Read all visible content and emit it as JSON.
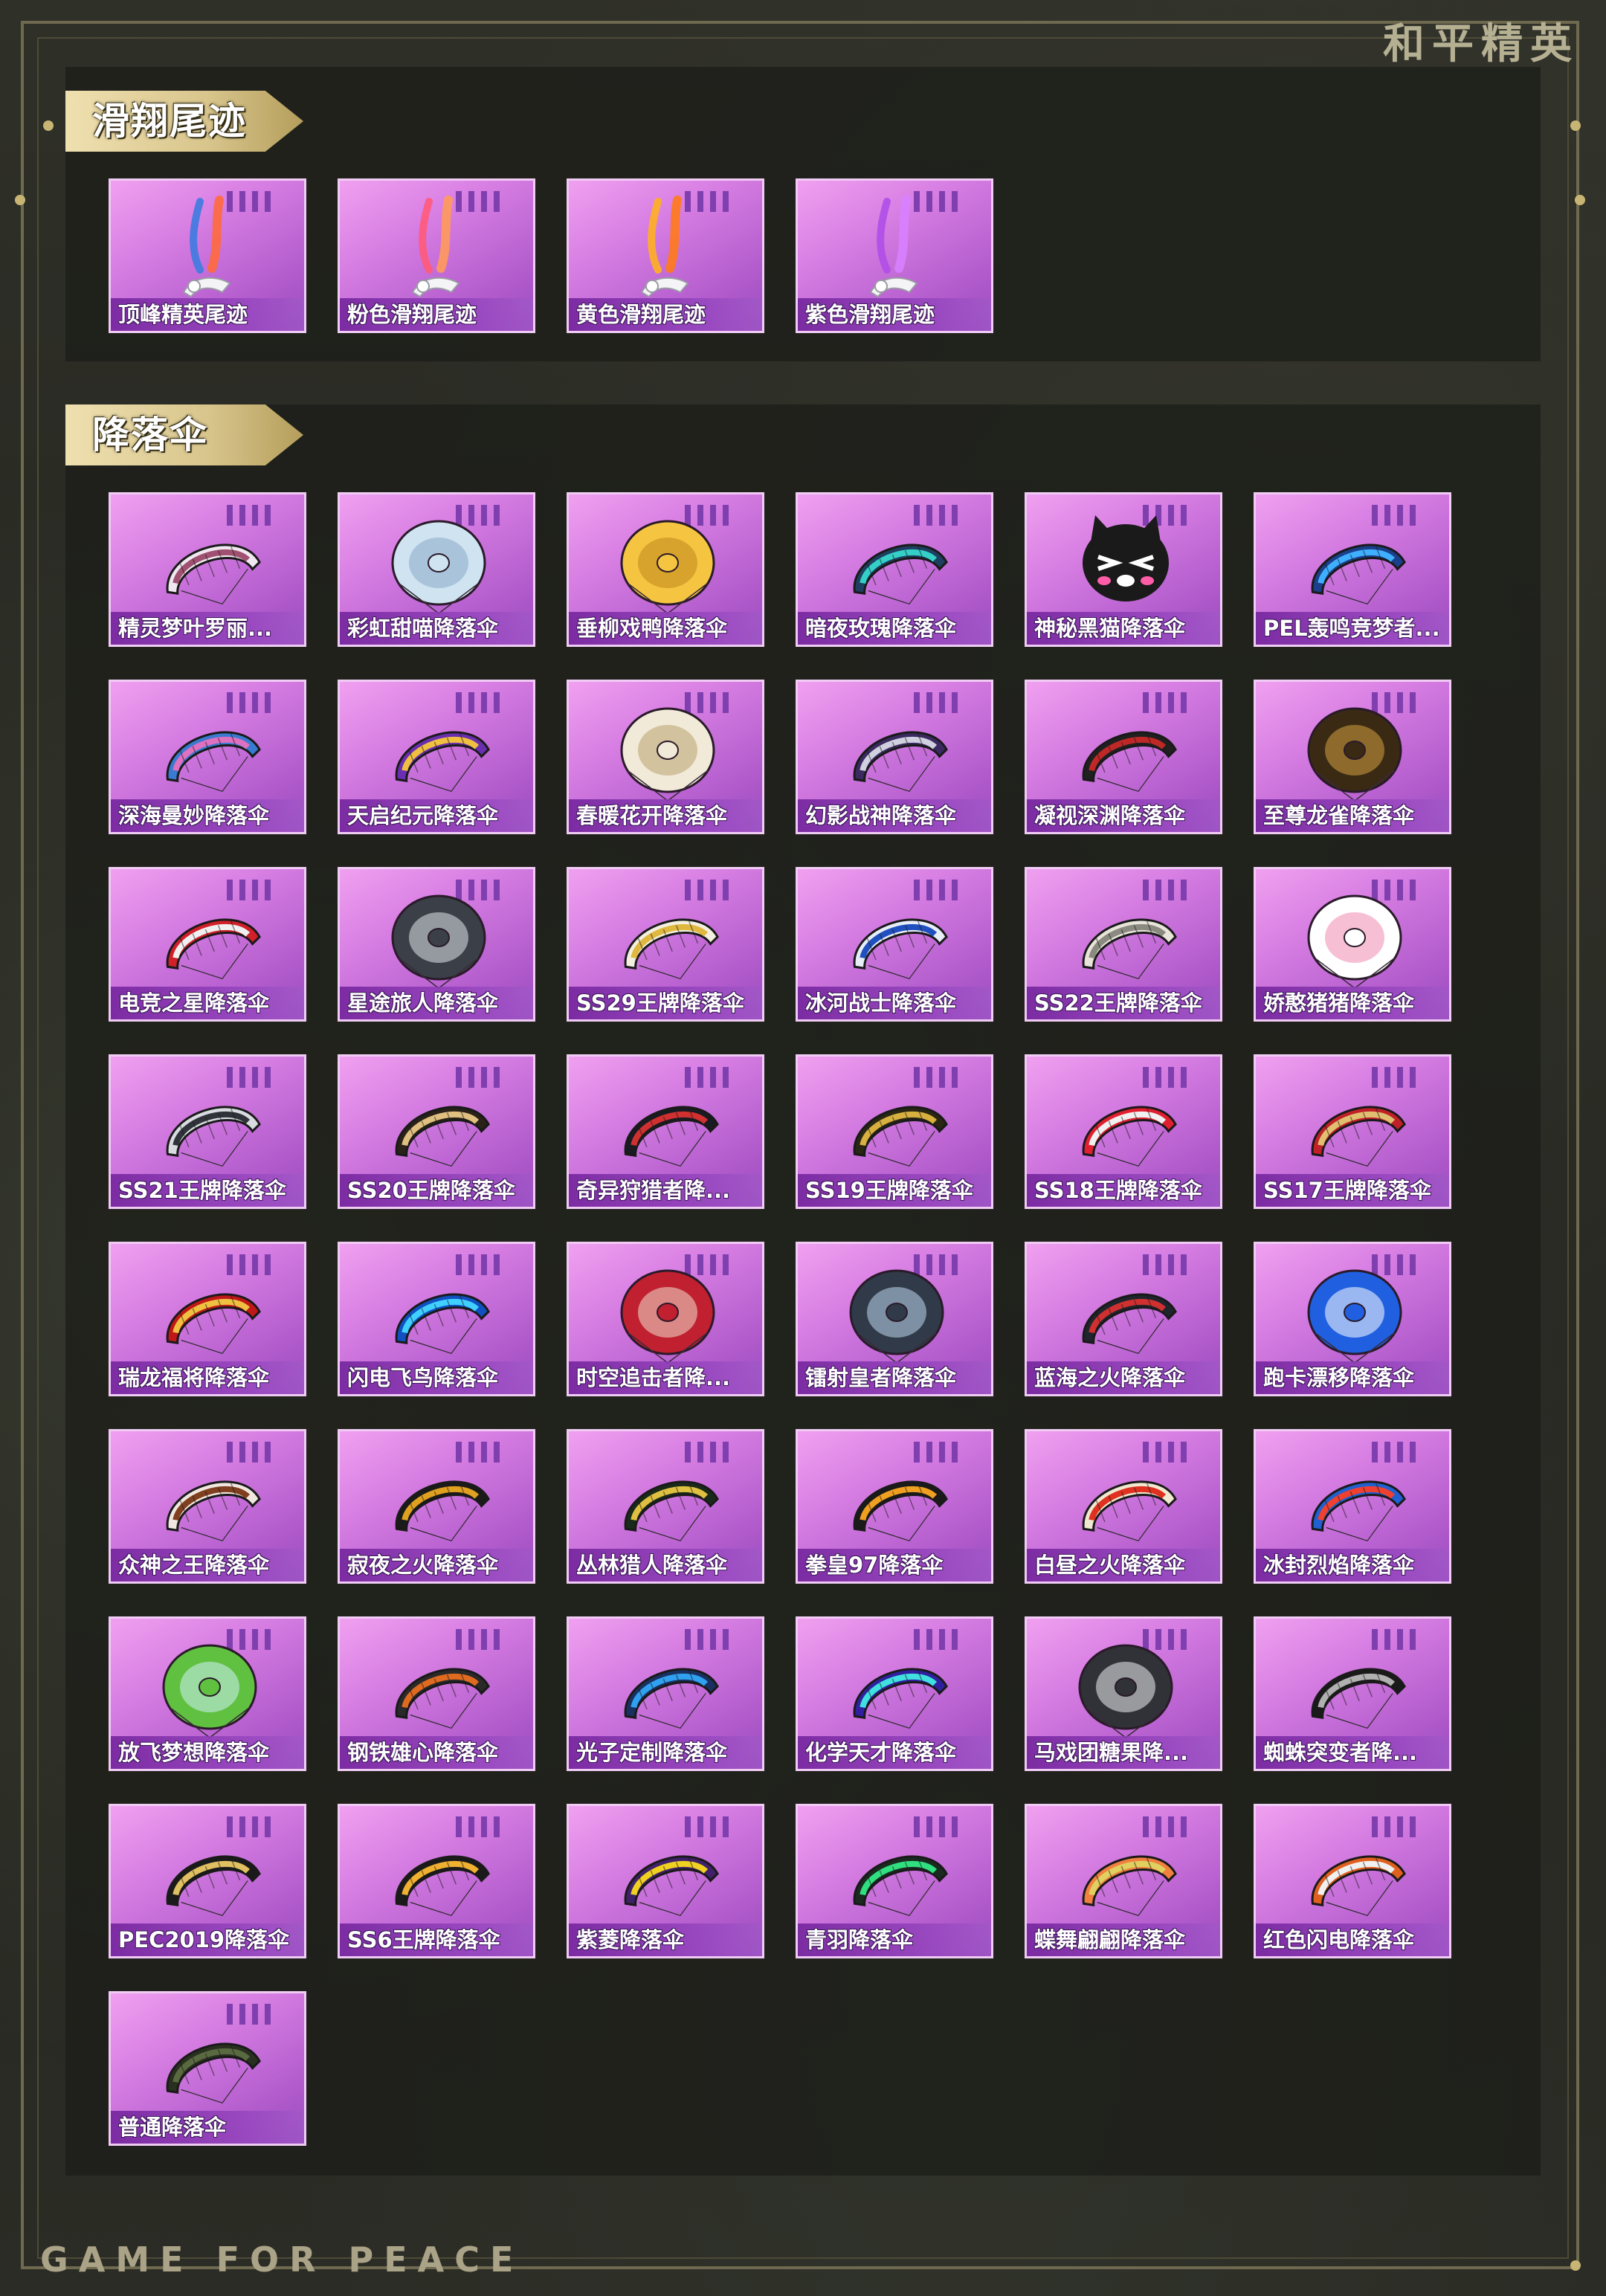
{
  "brand": {
    "top": "和平精英",
    "bottom": "GAME FOR PEACE"
  },
  "colors": {
    "card": "#d77ee3",
    "accent_gold": "#d8c58c",
    "frame": "#6f6a4f"
  },
  "sections": [
    {
      "title": "滑翔尾迹",
      "items": [
        {
          "label": "顶峰精英尾迹",
          "icon": "trail-icon",
          "colors": [
            "#3d7be0",
            "#ff6a3d"
          ]
        },
        {
          "label": "粉色滑翔尾迹",
          "icon": "trail-icon",
          "colors": [
            "#ff5a7a",
            "#ff9a5a"
          ]
        },
        {
          "label": "黄色滑翔尾迹",
          "icon": "trail-icon",
          "colors": [
            "#ffb020",
            "#ff7a1a"
          ]
        },
        {
          "label": "紫色滑翔尾迹",
          "icon": "trail-icon",
          "colors": [
            "#b04ee8",
            "#d880ff"
          ]
        }
      ]
    },
    {
      "title": "降落伞",
      "items": [
        {
          "label": "精灵梦叶罗丽...",
          "icon": "parachute-icon",
          "style": "wing",
          "colors": [
            "#f0e8f0",
            "#a05070"
          ]
        },
        {
          "label": "彩虹甜喵降落伞",
          "icon": "parachute-icon",
          "style": "dome",
          "colors": [
            "#cfe4f0",
            "#8aa8c8"
          ]
        },
        {
          "label": "垂柳戏鸭降落伞",
          "icon": "parachute-icon",
          "style": "dome",
          "colors": [
            "#f5c542",
            "#c0861c"
          ]
        },
        {
          "label": "暗夜玫瑰降落伞",
          "icon": "parachute-icon",
          "style": "wing",
          "colors": [
            "#1f3f60",
            "#34d0c8"
          ]
        },
        {
          "label": "神秘黑猫降落伞",
          "icon": "parachute-icon",
          "style": "cat",
          "colors": [
            "#1a1a1a",
            "#ff5da8"
          ]
        },
        {
          "label": "PEL轰鸣竞梦者...",
          "icon": "parachute-icon",
          "style": "wing",
          "colors": [
            "#1b3f8a",
            "#3fb0ff"
          ]
        },
        {
          "label": "深海曼妙降落伞",
          "icon": "parachute-icon",
          "style": "wing",
          "colors": [
            "#3a7ad0",
            "#e070c0"
          ]
        },
        {
          "label": "天启纪元降落伞",
          "icon": "parachute-icon",
          "style": "wing",
          "colors": [
            "#6a2fb0",
            "#f0c040"
          ]
        },
        {
          "label": "春暖花开降落伞",
          "icon": "parachute-icon",
          "style": "dome",
          "colors": [
            "#f2ead8",
            "#b8a070"
          ]
        },
        {
          "label": "幻影战神降落伞",
          "icon": "parachute-icon",
          "style": "wing",
          "colors": [
            "#3a2a60",
            "#d0d0e0"
          ]
        },
        {
          "label": "凝视深渊降落伞",
          "icon": "parachute-icon",
          "style": "wing",
          "colors": [
            "#202020",
            "#c02828"
          ]
        },
        {
          "label": "至尊龙雀降落伞",
          "icon": "parachute-icon",
          "style": "dome",
          "colors": [
            "#3a2a14",
            "#d4a040"
          ]
        },
        {
          "label": "电竞之星降落伞",
          "icon": "parachute-icon",
          "style": "wing",
          "colors": [
            "#d0202a",
            "#f0f0f0"
          ]
        },
        {
          "label": "星途旅人降落伞",
          "icon": "parachute-icon",
          "style": "dome",
          "colors": [
            "#3a3f48",
            "#e0e4ea"
          ]
        },
        {
          "label": "SS29王牌降落伞",
          "icon": "parachute-icon",
          "style": "wing",
          "colors": [
            "#f4f0e0",
            "#e0b840"
          ]
        },
        {
          "label": "冰河战士降落伞",
          "icon": "parachute-icon",
          "style": "wing",
          "colors": [
            "#e8eef8",
            "#2050c0"
          ]
        },
        {
          "label": "SS22王牌降落伞",
          "icon": "parachute-icon",
          "style": "wing",
          "colors": [
            "#e8e4da",
            "#8a8a80"
          ]
        },
        {
          "label": "娇憨猪猪降落伞",
          "icon": "parachute-icon",
          "style": "dome",
          "colors": [
            "#ffffff",
            "#f08ab0"
          ]
        },
        {
          "label": "SS21王牌降落伞",
          "icon": "parachute-icon",
          "style": "wing",
          "colors": [
            "#d8dce0",
            "#30343a"
          ]
        },
        {
          "label": "SS20王牌降落伞",
          "icon": "parachute-icon",
          "style": "wing",
          "colors": [
            "#2a2218",
            "#e0c080"
          ]
        },
        {
          "label": "奇异狩猎者降...",
          "icon": "parachute-icon",
          "style": "wing",
          "colors": [
            "#1a1a22",
            "#d03030"
          ]
        },
        {
          "label": "SS19王牌降落伞",
          "icon": "parachute-icon",
          "style": "wing",
          "colors": [
            "#2a2614",
            "#d8b040"
          ]
        },
        {
          "label": "SS18王牌降落伞",
          "icon": "parachute-icon",
          "style": "wing",
          "colors": [
            "#e02030",
            "#f0f0f0"
          ]
        },
        {
          "label": "SS17王牌降落伞",
          "icon": "parachute-icon",
          "style": "wing",
          "colors": [
            "#c02028",
            "#e0c070"
          ]
        },
        {
          "label": "瑞龙福将降落伞",
          "icon": "parachute-icon",
          "style": "wing",
          "colors": [
            "#c01818",
            "#f0c040"
          ]
        },
        {
          "label": "闪电飞鸟降落伞",
          "icon": "parachute-icon",
          "style": "wing",
          "colors": [
            "#1050c0",
            "#40d0ff"
          ]
        },
        {
          "label": "时空追击者降...",
          "icon": "parachute-icon",
          "style": "dome",
          "colors": [
            "#c02030",
            "#f0e0d0"
          ]
        },
        {
          "label": "镭射皇者降落伞",
          "icon": "parachute-icon",
          "style": "dome",
          "colors": [
            "#303a48",
            "#c0d8f0"
          ]
        },
        {
          "label": "蓝海之火降落伞",
          "icon": "parachute-icon",
          "style": "wing",
          "colors": [
            "#20242c",
            "#d03030"
          ]
        },
        {
          "label": "跑卡漂移降落伞",
          "icon": "parachute-icon",
          "style": "dome",
          "colors": [
            "#2060e0",
            "#ffffff"
          ]
        },
        {
          "label": "众神之王降落伞",
          "icon": "parachute-icon",
          "style": "wing",
          "colors": [
            "#f0e8e0",
            "#804020"
          ]
        },
        {
          "label": "寂夜之火降落伞",
          "icon": "parachute-icon",
          "style": "wing",
          "colors": [
            "#1a1a1a",
            "#e0a020"
          ]
        },
        {
          "label": "丛林猎人降落伞",
          "icon": "parachute-icon",
          "style": "wing",
          "colors": [
            "#1a2a1a",
            "#e0c040"
          ]
        },
        {
          "label": "拳皇97降落伞",
          "icon": "parachute-icon",
          "style": "wing",
          "colors": [
            "#1a1a1a",
            "#f0a020"
          ]
        },
        {
          "label": "白昼之火降落伞",
          "icon": "parachute-icon",
          "style": "wing",
          "colors": [
            "#f0e8d0",
            "#e03020"
          ]
        },
        {
          "label": "冰封烈焰降落伞",
          "icon": "parachute-icon",
          "style": "wing",
          "colors": [
            "#2060d0",
            "#f04030"
          ]
        },
        {
          "label": "放飞梦想降落伞",
          "icon": "parachute-icon",
          "style": "dome",
          "colors": [
            "#60c040",
            "#d0f0f8"
          ]
        },
        {
          "label": "钢铁雄心降落伞",
          "icon": "parachute-icon",
          "style": "wing",
          "colors": [
            "#2a2a2a",
            "#e06a20"
          ]
        },
        {
          "label": "光子定制降落伞",
          "icon": "parachute-icon",
          "style": "wing",
          "colors": [
            "#1a3060",
            "#30a0f0"
          ]
        },
        {
          "label": "化学天才降落伞",
          "icon": "parachute-icon",
          "style": "wing",
          "colors": [
            "#3020a0",
            "#40e0e0"
          ]
        },
        {
          "label": "马戏团糖果降...",
          "icon": "parachute-icon",
          "style": "dome",
          "colors": [
            "#303238",
            "#f0f0f0"
          ]
        },
        {
          "label": "蜘蛛突变者降...",
          "icon": "parachute-icon",
          "style": "wing",
          "colors": [
            "#1a1a1a",
            "#b0b0b0"
          ]
        },
        {
          "label": "PEC2019降落伞",
          "icon": "parachute-icon",
          "style": "wing",
          "colors": [
            "#1a1a1a",
            "#e0c060"
          ]
        },
        {
          "label": "SS6王牌降落伞",
          "icon": "parachute-icon",
          "style": "wing",
          "colors": [
            "#1a1a1a",
            "#f0b030"
          ]
        },
        {
          "label": "紫菱降落伞",
          "icon": "parachute-icon",
          "style": "wing",
          "colors": [
            "#40206a",
            "#f0d020"
          ]
        },
        {
          "label": "青羽降落伞",
          "icon": "parachute-icon",
          "style": "wing",
          "colors": [
            "#1a2a20",
            "#30e080"
          ]
        },
        {
          "label": "蝶舞翩翩降落伞",
          "icon": "parachute-icon",
          "style": "wing",
          "colors": [
            "#f08040",
            "#e0d060"
          ]
        },
        {
          "label": "红色闪电降落伞",
          "icon": "parachute-icon",
          "style": "wing",
          "colors": [
            "#e06020",
            "#f0f0f0"
          ]
        },
        {
          "label": "普通降落伞",
          "icon": "parachute-icon",
          "style": "wing",
          "colors": [
            "#2a3020",
            "#5a6a40"
          ]
        }
      ]
    }
  ]
}
